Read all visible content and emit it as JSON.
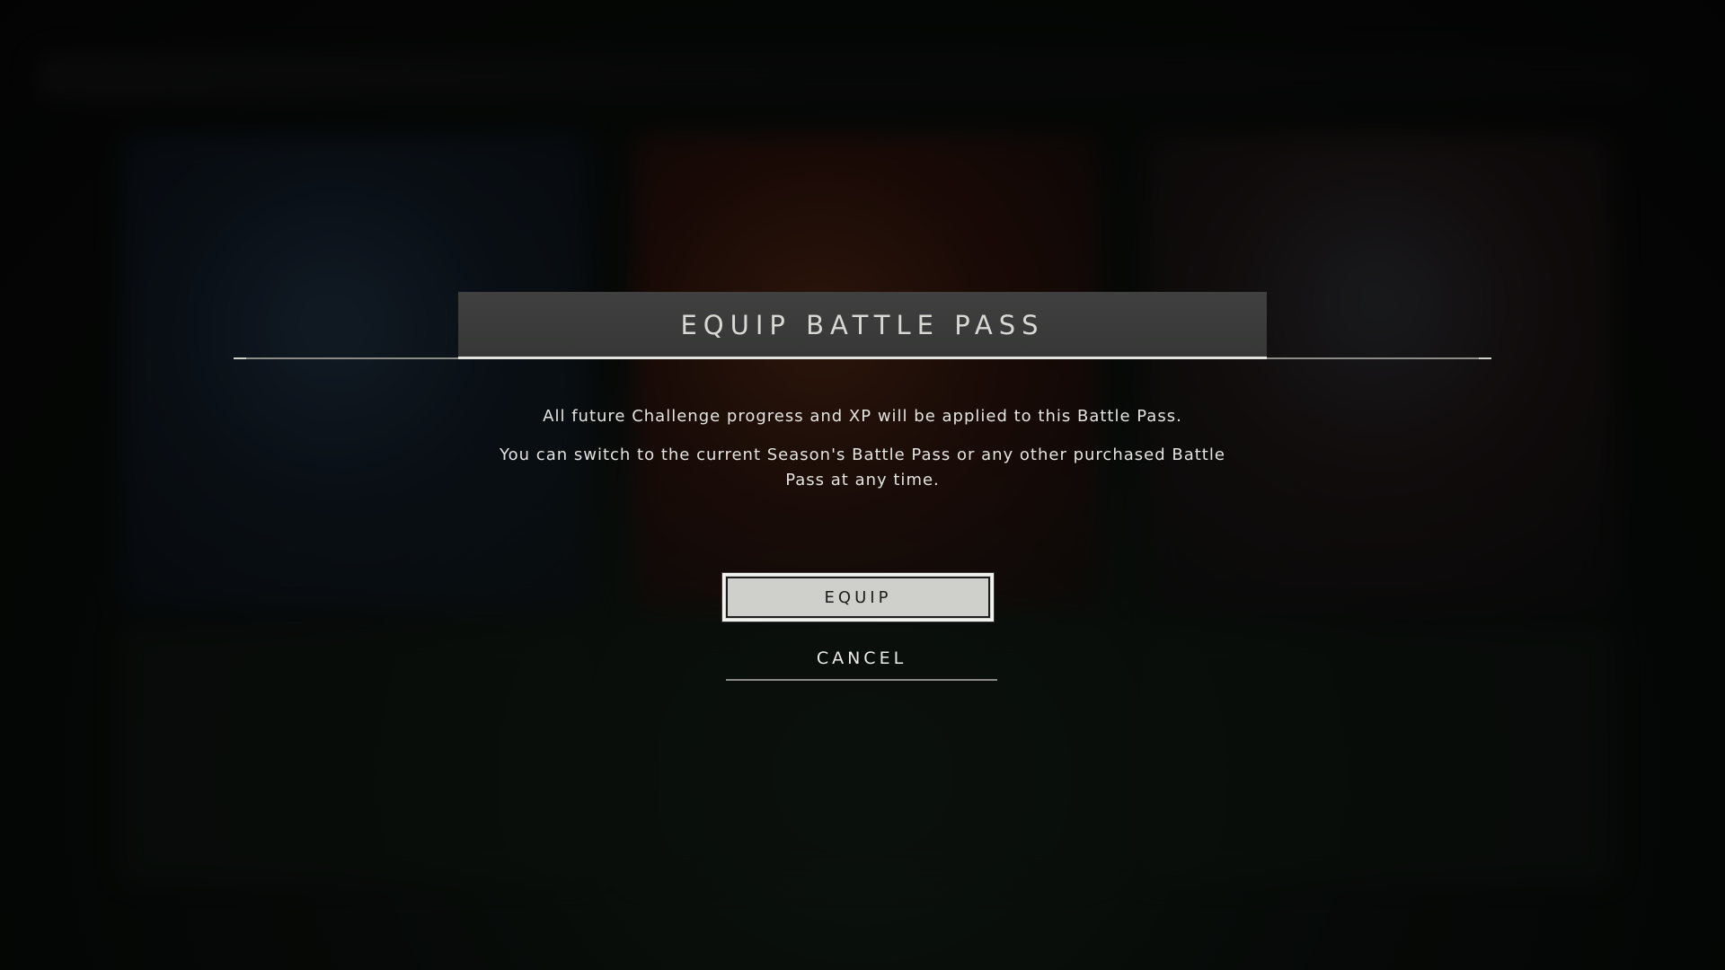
{
  "dialog": {
    "title": "EQUIP BATTLE PASS",
    "message_primary": "All future Challenge progress and XP will be applied to this Battle Pass.",
    "message_secondary": "You can switch to the current Season's Battle Pass or any other purchased Battle Pass at any time.",
    "equip_label": "EQUIP",
    "cancel_label": "CANCEL"
  },
  "colors": {
    "header_bg": "#3b3c3b",
    "equip_bg": "#cfd0cc",
    "text_light": "#e4e4e0"
  }
}
